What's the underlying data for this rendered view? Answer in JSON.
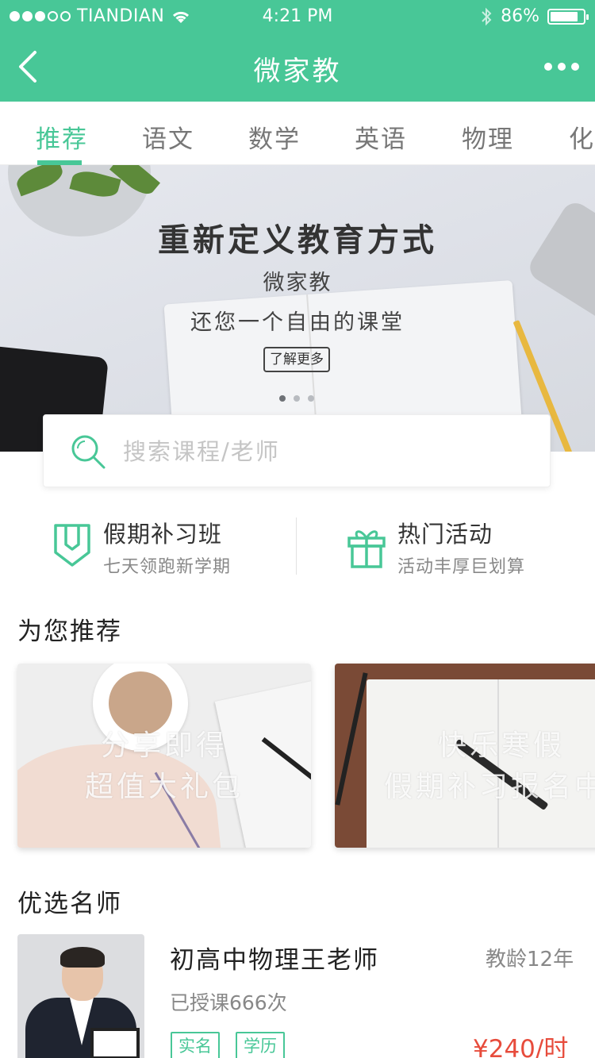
{
  "status_bar": {
    "carrier": "TIANDIAN",
    "time": "4:21 PM",
    "battery": "86%",
    "battery_level": 0.86
  },
  "nav": {
    "title": "微家教"
  },
  "tabs": [
    "推荐",
    "语文",
    "数学",
    "英语",
    "物理",
    "化"
  ],
  "active_tab": 0,
  "banner": {
    "title": "重新定义教育方式",
    "subtitle1": "微家教",
    "subtitle2": "还您一个自由的课堂",
    "button": "了解更多",
    "page_count": 3,
    "active_page": 0
  },
  "search": {
    "placeholder": "搜索课程/老师"
  },
  "quick": [
    {
      "title": "假期补习班",
      "desc": "七天领跑新学期",
      "icon": "bookmark-shield-icon"
    },
    {
      "title": "热门活动",
      "desc": "活动丰厚巨划算",
      "icon": "gift-icon"
    }
  ],
  "recommend": {
    "title": "为您推荐",
    "cards": [
      {
        "line1": "分享即得",
        "line2": "超值大礼包"
      },
      {
        "line1": "快乐寒假",
        "line2": "假期补习报名中"
      }
    ]
  },
  "teachers": {
    "title": "优选名师",
    "items": [
      {
        "name": "初高中物理王老师",
        "experience": "教龄12年",
        "lessons": "已授课666次",
        "tags": [
          "实名",
          "学历"
        ],
        "price": "¥240/时"
      }
    ]
  },
  "colors": {
    "accent": "#48c797",
    "price": "#e74c3c"
  }
}
